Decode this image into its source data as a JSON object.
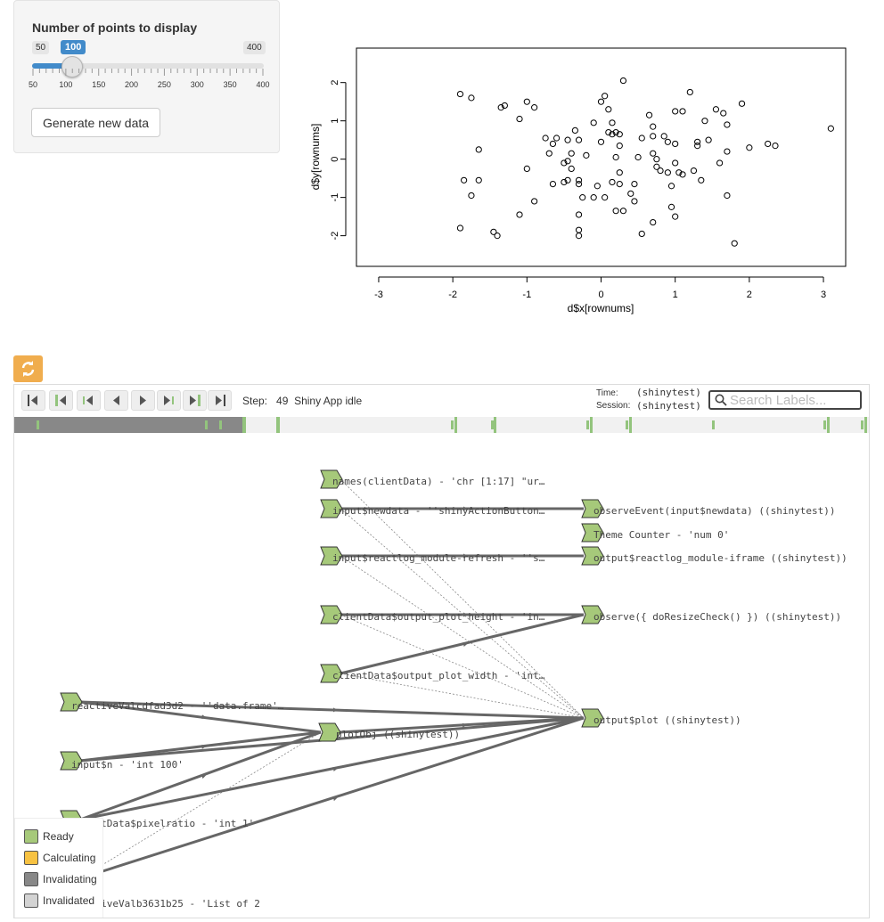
{
  "slider": {
    "label": "Number of points to display",
    "min_label": "50",
    "max_label": "400",
    "value_label": "100",
    "value": 100,
    "min": 50,
    "max": 400,
    "tick_labels": [
      "50",
      "100",
      "150",
      "200",
      "250",
      "300",
      "350",
      "400"
    ]
  },
  "button": {
    "label": "Generate new data"
  },
  "plot": {
    "xlabel": "d$x[rownums]",
    "ylabel": "d$y[rownums]",
    "x_ticks": [
      "-3",
      "-2",
      "-1",
      "0",
      "1",
      "2",
      "3"
    ],
    "y_ticks": [
      "2",
      "1",
      "0",
      "-1",
      "-2"
    ]
  },
  "chart_data": {
    "type": "scatter",
    "xlabel": "d$x[rownums]",
    "ylabel": "d$y[rownums]",
    "xlim": [
      -3.3,
      3.3
    ],
    "ylim": [
      -2.8,
      2.9
    ],
    "points": [
      [
        -1.9,
        1.7
      ],
      [
        -1.75,
        1.6
      ],
      [
        -1.35,
        1.35
      ],
      [
        -1.3,
        1.4
      ],
      [
        -1.1,
        1.05
      ],
      [
        -1.0,
        1.5
      ],
      [
        -0.9,
        1.35
      ],
      [
        -1.65,
        0.25
      ],
      [
        -1.85,
        -0.55
      ],
      [
        -1.65,
        -0.55
      ],
      [
        -1.75,
        -0.95
      ],
      [
        -1.0,
        -0.25
      ],
      [
        -0.9,
        -1.1
      ],
      [
        -1.1,
        -1.45
      ],
      [
        -1.9,
        -1.8
      ],
      [
        -1.45,
        -1.9
      ],
      [
        -1.4,
        -2.0
      ],
      [
        -0.75,
        0.55
      ],
      [
        -0.7,
        0.15
      ],
      [
        -0.65,
        0.4
      ],
      [
        -0.6,
        0.55
      ],
      [
        -0.45,
        0.5
      ],
      [
        -0.4,
        0.15
      ],
      [
        -0.35,
        0.75
      ],
      [
        -0.3,
        0.5
      ],
      [
        -0.2,
        0.1
      ],
      [
        -0.1,
        0.95
      ],
      [
        -0.45,
        -0.05
      ],
      [
        -0.4,
        -0.25
      ],
      [
        -0.45,
        -0.55
      ],
      [
        -0.3,
        -0.55
      ],
      [
        -0.5,
        -0.6
      ],
      [
        -0.3,
        -0.65
      ],
      [
        -0.65,
        -0.65
      ],
      [
        -0.25,
        -1.0
      ],
      [
        -0.5,
        -0.1
      ],
      [
        -0.3,
        -1.45
      ],
      [
        -0.3,
        -1.85
      ],
      [
        -0.3,
        -2.0
      ],
      [
        -0.1,
        -1.0
      ],
      [
        -0.05,
        -0.7
      ],
      [
        0.0,
        1.5
      ],
      [
        0.05,
        1.65
      ],
      [
        0.1,
        1.3
      ],
      [
        0.15,
        0.95
      ],
      [
        0.15,
        0.65
      ],
      [
        0.1,
        0.7
      ],
      [
        0.2,
        0.7
      ],
      [
        0.25,
        0.35
      ],
      [
        0.25,
        0.65
      ],
      [
        0.0,
        0.45
      ],
      [
        0.2,
        0.05
      ],
      [
        0.25,
        -0.35
      ],
      [
        0.25,
        -0.65
      ],
      [
        0.15,
        -0.6
      ],
      [
        0.05,
        -1.0
      ],
      [
        0.2,
        -1.35
      ],
      [
        0.3,
        -1.35
      ],
      [
        0.45,
        -0.65
      ],
      [
        0.5,
        0.05
      ],
      [
        0.55,
        0.55
      ],
      [
        0.65,
        1.15
      ],
      [
        0.7,
        0.6
      ],
      [
        0.7,
        0.85
      ],
      [
        0.85,
        0.6
      ],
      [
        0.9,
        0.45
      ],
      [
        0.9,
        -0.35
      ],
      [
        1.0,
        0.4
      ],
      [
        1.0,
        1.25
      ],
      [
        1.1,
        1.25
      ],
      [
        1.2,
        1.75
      ],
      [
        0.7,
        0.15
      ],
      [
        0.75,
        -0.2
      ],
      [
        0.75,
        0.0
      ],
      [
        0.8,
        -0.3
      ],
      [
        0.95,
        -0.7
      ],
      [
        1.0,
        -0.1
      ],
      [
        1.05,
        -0.35
      ],
      [
        1.1,
        -0.4
      ],
      [
        0.95,
        -1.25
      ],
      [
        1.0,
        -1.5
      ],
      [
        0.7,
        -1.65
      ],
      [
        0.55,
        -1.95
      ],
      [
        0.4,
        -0.9
      ],
      [
        0.45,
        -1.1
      ],
      [
        1.25,
        -0.3
      ],
      [
        1.3,
        0.35
      ],
      [
        1.3,
        0.45
      ],
      [
        1.35,
        -0.55
      ],
      [
        1.4,
        1.0
      ],
      [
        1.45,
        0.5
      ],
      [
        1.55,
        1.3
      ],
      [
        1.6,
        -0.1
      ],
      [
        1.65,
        1.2
      ],
      [
        1.7,
        0.9
      ],
      [
        1.7,
        0.2
      ],
      [
        1.7,
        -0.95
      ],
      [
        1.8,
        -2.2
      ],
      [
        1.9,
        1.45
      ],
      [
        2.0,
        0.3
      ],
      [
        2.25,
        0.4
      ],
      [
        2.35,
        0.35
      ],
      [
        3.1,
        0.8
      ],
      [
        0.3,
        2.05
      ]
    ]
  },
  "reactlog": {
    "step_label": "Step:",
    "step_value": "49",
    "step_desc": "Shiny App idle",
    "time_label": "Time:",
    "time_value": "(shinytest)",
    "session_label": "Session:",
    "session_value": "(shinytest)",
    "search_placeholder": "Search Labels..."
  },
  "nodes": [
    "names(clientData) - 'chr [1:17] \"ur…",
    "input$newdata - ''shinyActionButton…",
    "input$reactlog_module-refresh - ''s…",
    "clientData$output_plot_height - 'in…",
    "clientData$output_plot_width - 'int…",
    "reactiveValcdfad3d2 - ''data.frame'…",
    "input$n - 'int 100'",
    "clientData$pixelratio - 'int 1'",
    "reactiveValb3631b25 - 'List of 2",
    "plotObj ((shinytest))",
    "observeEvent(input$newdata) ((shinytest))",
    "Theme Counter - 'num 0'",
    "output$reactlog_module-iframe ((shinytest))",
    "observe({ doResizeCheck() }) ((shinytest))",
    "output$plot ((shinytest))"
  ],
  "legend": [
    {
      "label": "Ready",
      "color": "#a6c97a"
    },
    {
      "label": "Calculating",
      "color": "#f7c242"
    },
    {
      "label": "Invalidating",
      "color": "#888888"
    },
    {
      "label": "Invalidated",
      "color": "#d3d3d3"
    }
  ],
  "colors": {
    "accent": "#428bca",
    "node": "#a6c97a",
    "edge": "#666666",
    "refresh": "#f0ad4e",
    "timeline_marker": "#93c47d"
  }
}
